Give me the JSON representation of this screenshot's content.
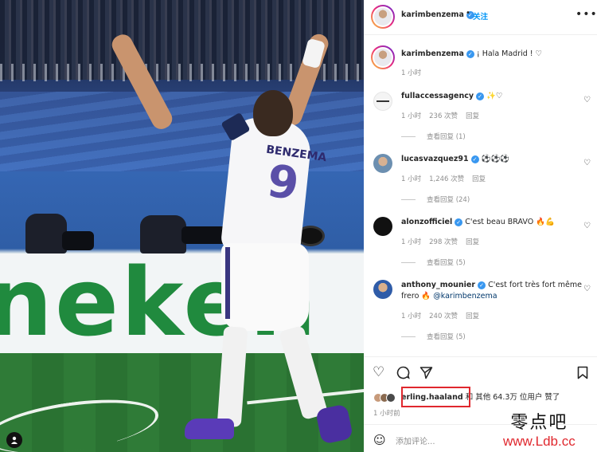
{
  "post": {
    "username": "karimbenzema",
    "follow_separator": "•",
    "follow_label": "关注",
    "more_icon": "more-icon",
    "caption": "¡ Hala Madrid ! ♡",
    "caption_time": "1 小时"
  },
  "photo": {
    "board_text": "neken",
    "jersey_name": "BENZEMA",
    "jersey_number": "9",
    "user_tag_icon": "user-tag-icon"
  },
  "comments": [
    {
      "username": "fullaccessagency",
      "text": "✨♡",
      "time": "1 小时",
      "likes": "236 次赞",
      "reply": "回复",
      "view_replies": "查看回复 (1)"
    },
    {
      "username": "lucasvazquez91",
      "text": "⚽⚽⚽",
      "time": "1 小时",
      "likes": "1,246 次赞",
      "reply": "回复",
      "view_replies": "查看回复 (24)"
    },
    {
      "username": "alonzofficiel",
      "text": "C'est beau BRAVO 🔥💪",
      "time": "1 小时",
      "likes": "298 次赞",
      "reply": "回复",
      "view_replies": "查看回复 (5)"
    },
    {
      "username": "anthony_mounier",
      "text": "C'est fort très fort même",
      "text2": "frero 🔥",
      "mention": "@karimbenzema",
      "time": "1 小时",
      "likes": "240 次赞",
      "reply": "回复",
      "view_replies": "查看回复 (5)"
    }
  ],
  "actions": {
    "liker": "erling.haaland",
    "likes_text": "和 其他 64.3万 位用户 赞了",
    "time": "1 小时前",
    "add_comment_placeholder": "添加评论..."
  },
  "watermark": {
    "chinese": "零点吧",
    "url": "www.Ldb.cc"
  },
  "colors": {
    "link": "#0095f6",
    "verified": "#3897f0",
    "highlight": "#e0282e",
    "board_green": "#208a3e"
  }
}
